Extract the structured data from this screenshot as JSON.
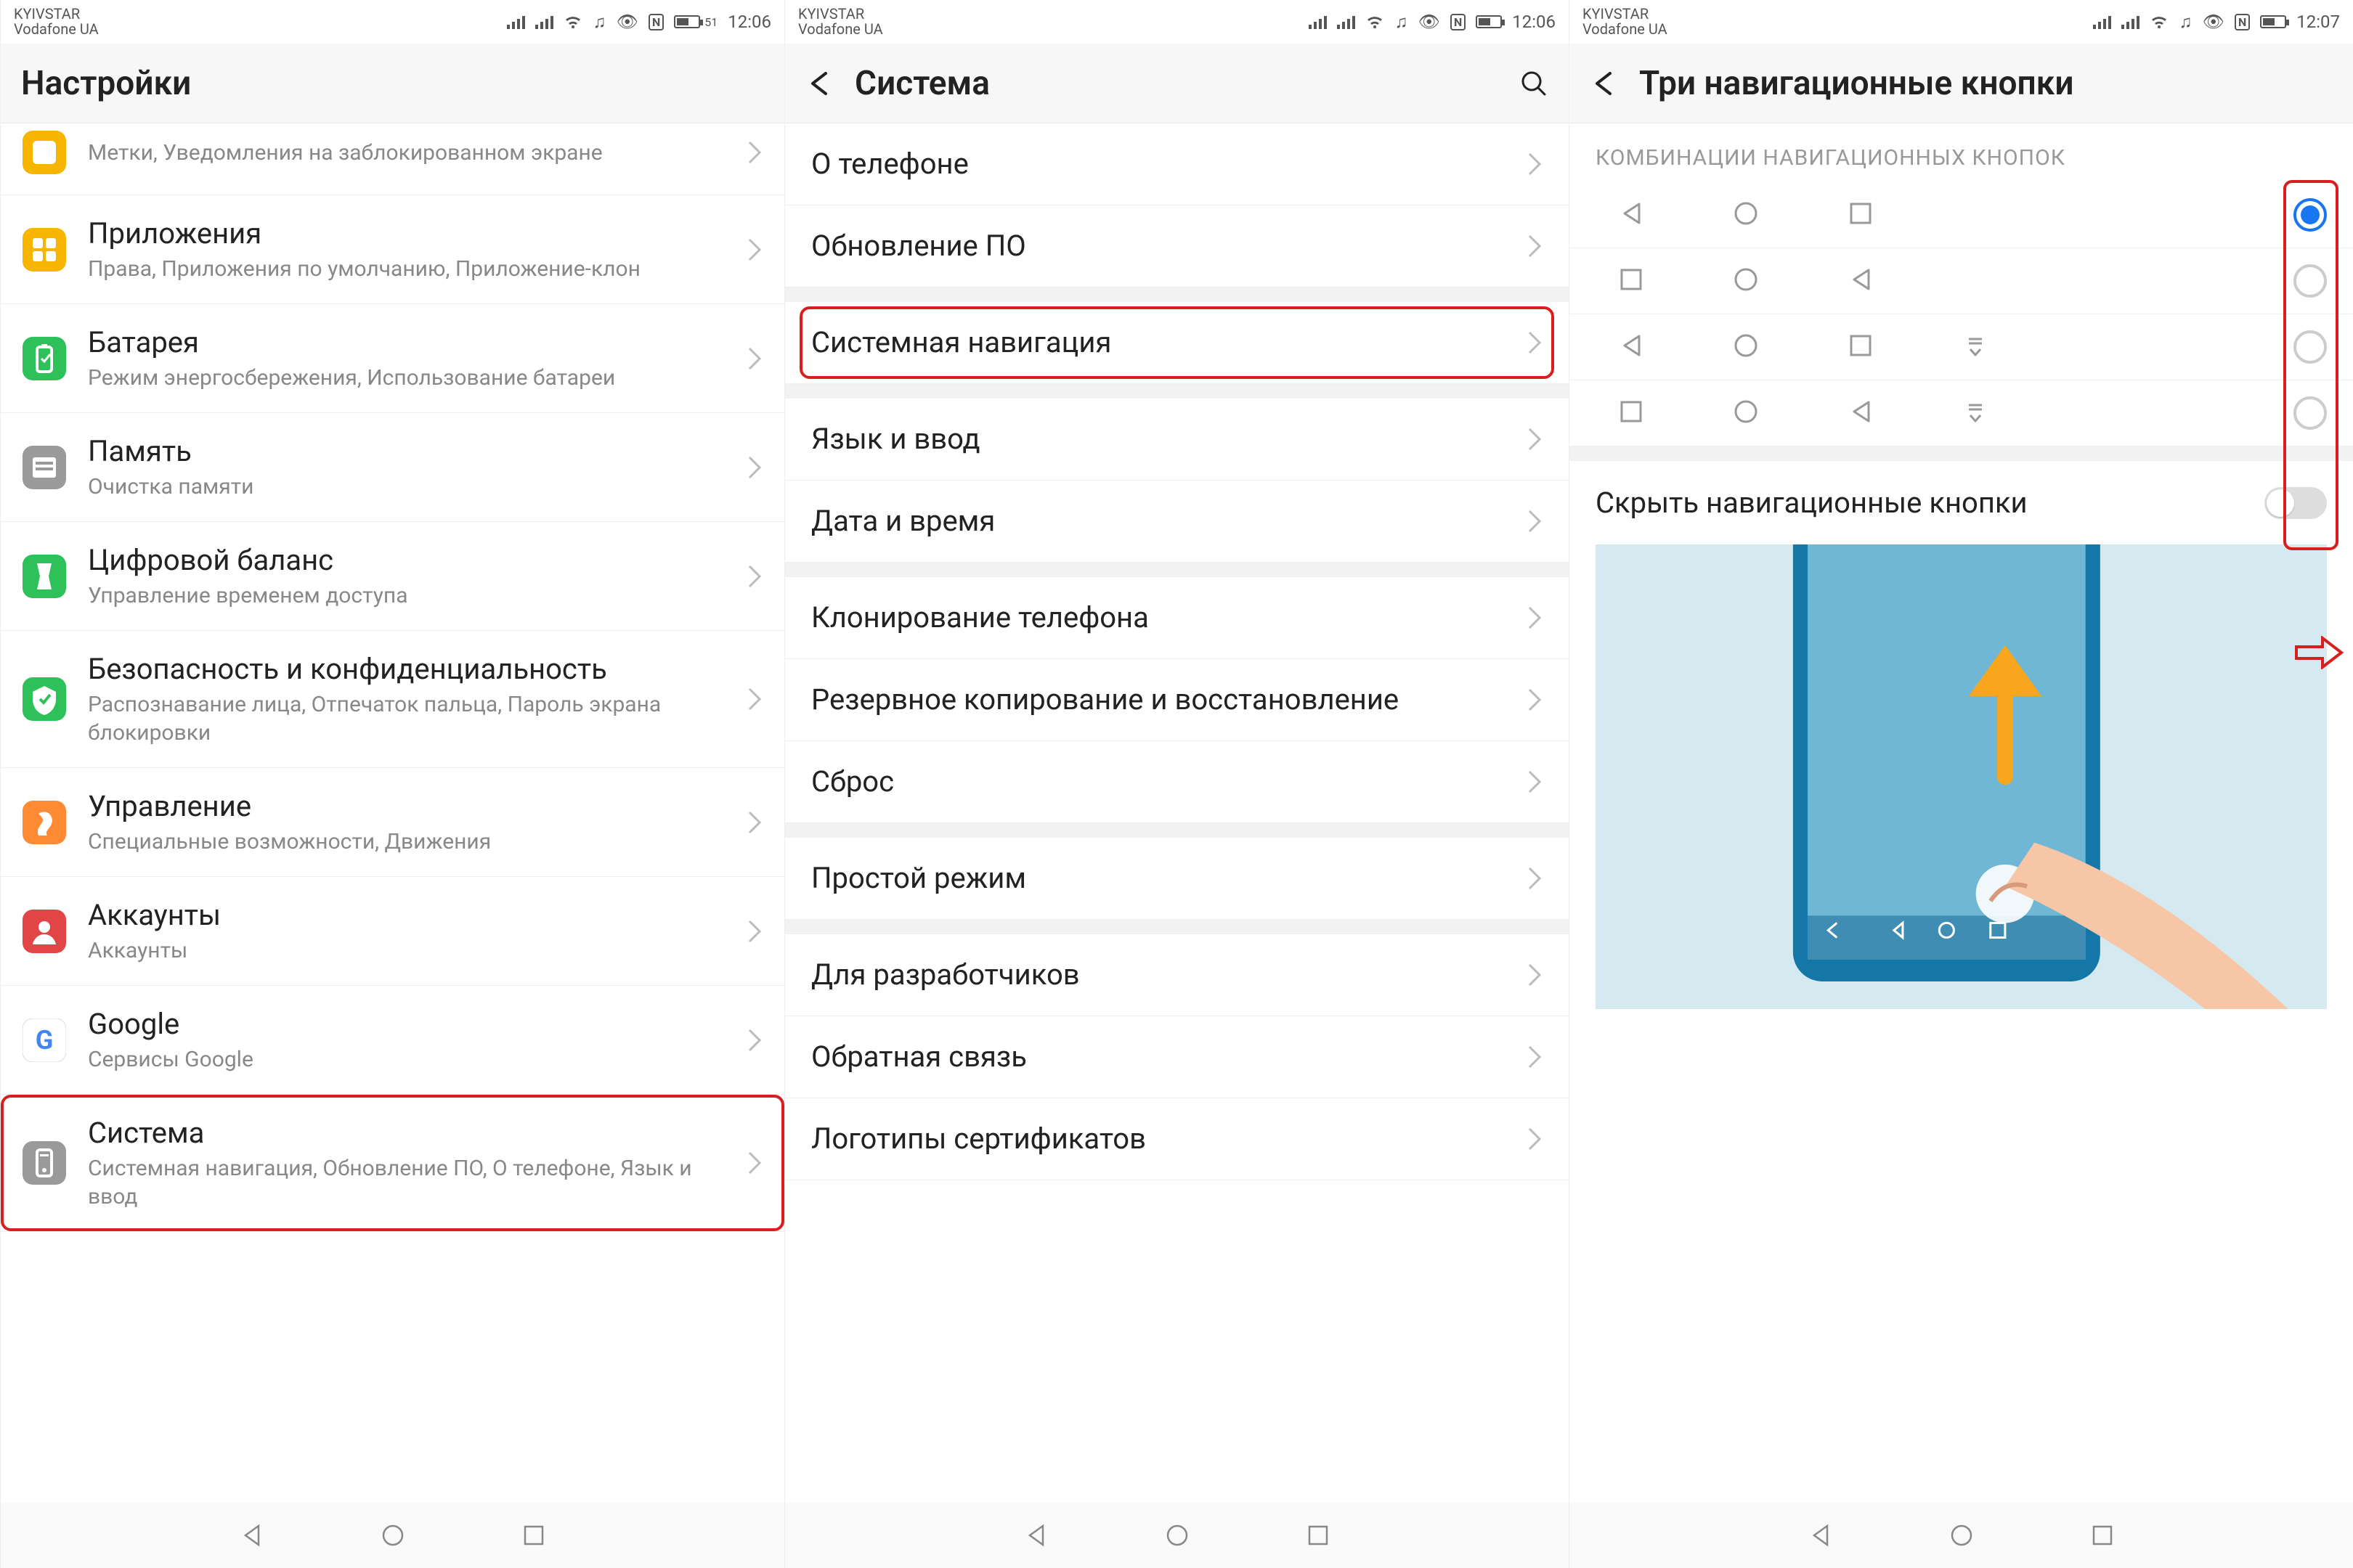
{
  "statusbar": {
    "carrier1": "KYIVSTAR",
    "carrier2": "Vodafone UA",
    "battery_pct": "51",
    "time_a": "12:06",
    "time_b": "12:07"
  },
  "panel1": {
    "title": "Настройки",
    "items": [
      {
        "title": "",
        "sub": "Метки, Уведомления на заблокированном экране",
        "iconColor": "#f7b500"
      },
      {
        "title": "Приложения",
        "sub": "Права, Приложения по умолчанию, Приложение-клон",
        "iconColor": "#f7b500"
      },
      {
        "title": "Батарея",
        "sub": "Режим энергосбережения, Использование батареи",
        "iconColor": "#2ec15a"
      },
      {
        "title": "Память",
        "sub": "Очистка памяти",
        "iconColor": "#9a9a9a"
      },
      {
        "title": "Цифровой баланс",
        "sub": "Управление временем доступа",
        "iconColor": "#2ec15a"
      },
      {
        "title": "Безопасность и конфиденциальность",
        "sub": "Распознавание лица, Отпечаток пальца, Пароль экрана блокировки",
        "iconColor": "#2ec15a"
      },
      {
        "title": "Управление",
        "sub": "Специальные возможности, Движения",
        "iconColor": "#ff8a34"
      },
      {
        "title": "Аккаунты",
        "sub": "Аккаунты",
        "iconColor": "#e24545"
      },
      {
        "title": "Google",
        "sub": "Сервисы Google",
        "iconColor": "#ffffff"
      },
      {
        "title": "Система",
        "sub": "Системная навигация, Обновление ПО, О телефоне, Язык и ввод",
        "iconColor": "#9a9a9a"
      }
    ]
  },
  "panel2": {
    "title": "Система",
    "groups": [
      [
        "О телефоне",
        "Обновление ПО"
      ],
      [
        "Системная навигация"
      ],
      [
        "Язык и ввод",
        "Дата и время"
      ],
      [
        "Клонирование телефона",
        "Резервное копирование и восстановление",
        "Сброс"
      ],
      [
        "Простой режим"
      ],
      [
        "Для разработчиков",
        "Обратная связь",
        "Логотипы сертификатов"
      ]
    ]
  },
  "panel3": {
    "title": "Три навигационные кнопки",
    "section": "КОМБИНАЦИИ НАВИГАЦИОННЫХ КНОПОК",
    "hide_label": "Скрыть навигационные кнопки",
    "combos": [
      {
        "icons": [
          "tri-left",
          "circle",
          "square"
        ],
        "selected": true
      },
      {
        "icons": [
          "square",
          "circle",
          "tri-left"
        ],
        "selected": false
      },
      {
        "icons": [
          "tri-left",
          "circle",
          "square",
          "pulldown"
        ],
        "selected": false
      },
      {
        "icons": [
          "square",
          "circle",
          "tri-left",
          "pulldown"
        ],
        "selected": false
      }
    ]
  }
}
